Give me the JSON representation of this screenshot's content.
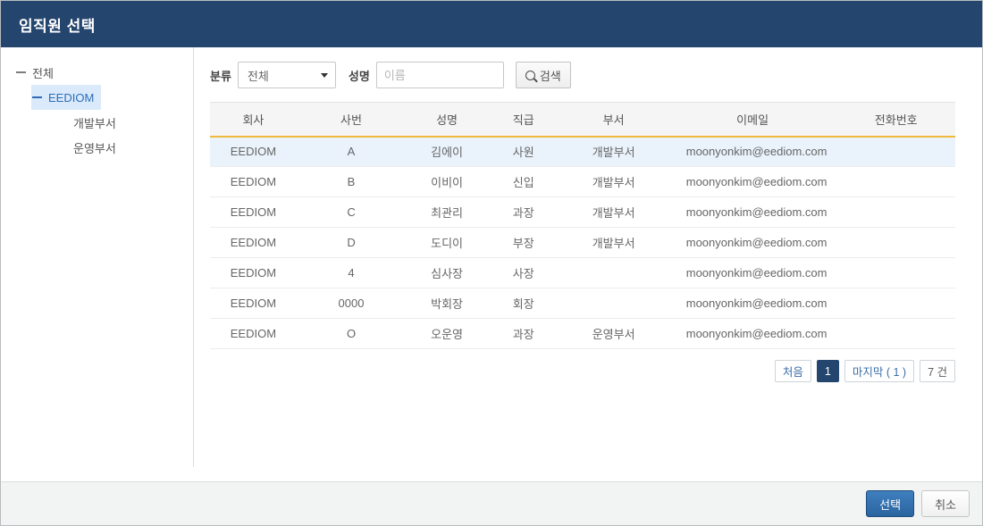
{
  "header": {
    "title": "임직원 선택"
  },
  "sidebar": {
    "nodes": [
      {
        "label": "전체",
        "level": 0,
        "icon": "minus-icon",
        "selected": false
      },
      {
        "label": "EEDIOM",
        "level": 1,
        "icon": "minus-icon",
        "selected": true
      },
      {
        "label": "개발부서",
        "level": 2,
        "icon": "none",
        "selected": false
      },
      {
        "label": "운영부서",
        "level": 2,
        "icon": "none",
        "selected": false
      }
    ]
  },
  "search": {
    "category_label": "분류",
    "category_value": "전체",
    "name_label": "성명",
    "name_value": "",
    "name_placeholder": "이름",
    "search_button": "검색",
    "search_icon": "magnifier-icon"
  },
  "table": {
    "columns": [
      "회사",
      "사번",
      "성명",
      "직급",
      "부서",
      "이메일",
      "전화번호"
    ],
    "rows": [
      {
        "company": "EEDIOM",
        "empno": "A",
        "name": "김에이",
        "rank": "사원",
        "dept": "개발부서",
        "email": "moonyonkim@eediom.com",
        "phone": "",
        "selected": true
      },
      {
        "company": "EEDIOM",
        "empno": "B",
        "name": "이비이",
        "rank": "신입",
        "dept": "개발부서",
        "email": "moonyonkim@eediom.com",
        "phone": "",
        "selected": false
      },
      {
        "company": "EEDIOM",
        "empno": "C",
        "name": "최관리",
        "rank": "과장",
        "dept": "개발부서",
        "email": "moonyonkim@eediom.com",
        "phone": "",
        "selected": false
      },
      {
        "company": "EEDIOM",
        "empno": "D",
        "name": "도디이",
        "rank": "부장",
        "dept": "개발부서",
        "email": "moonyonkim@eediom.com",
        "phone": "",
        "selected": false
      },
      {
        "company": "EEDIOM",
        "empno": "4",
        "name": "심사장",
        "rank": "사장",
        "dept": "",
        "email": "moonyonkim@eediom.com",
        "phone": "",
        "selected": false
      },
      {
        "company": "EEDIOM",
        "empno": "0000",
        "name": "박회장",
        "rank": "회장",
        "dept": "",
        "email": "moonyonkim@eediom.com",
        "phone": "",
        "selected": false
      },
      {
        "company": "EEDIOM",
        "empno": "O",
        "name": "오운영",
        "rank": "과장",
        "dept": "운영부서",
        "email": "moonyonkim@eediom.com",
        "phone": "",
        "selected": false
      }
    ]
  },
  "pagination": {
    "first": "처음",
    "current": "1",
    "last": "마지막 ( 1 )",
    "count": "7 건"
  },
  "footer": {
    "confirm": "선택",
    "cancel": "취소"
  },
  "colors": {
    "header_bg": "#24456e",
    "accent_gold": "#f0ba3c",
    "row_selected": "#eaf3fc",
    "tree_selected": "#dbeafb",
    "primary_button": "#2a659f"
  }
}
